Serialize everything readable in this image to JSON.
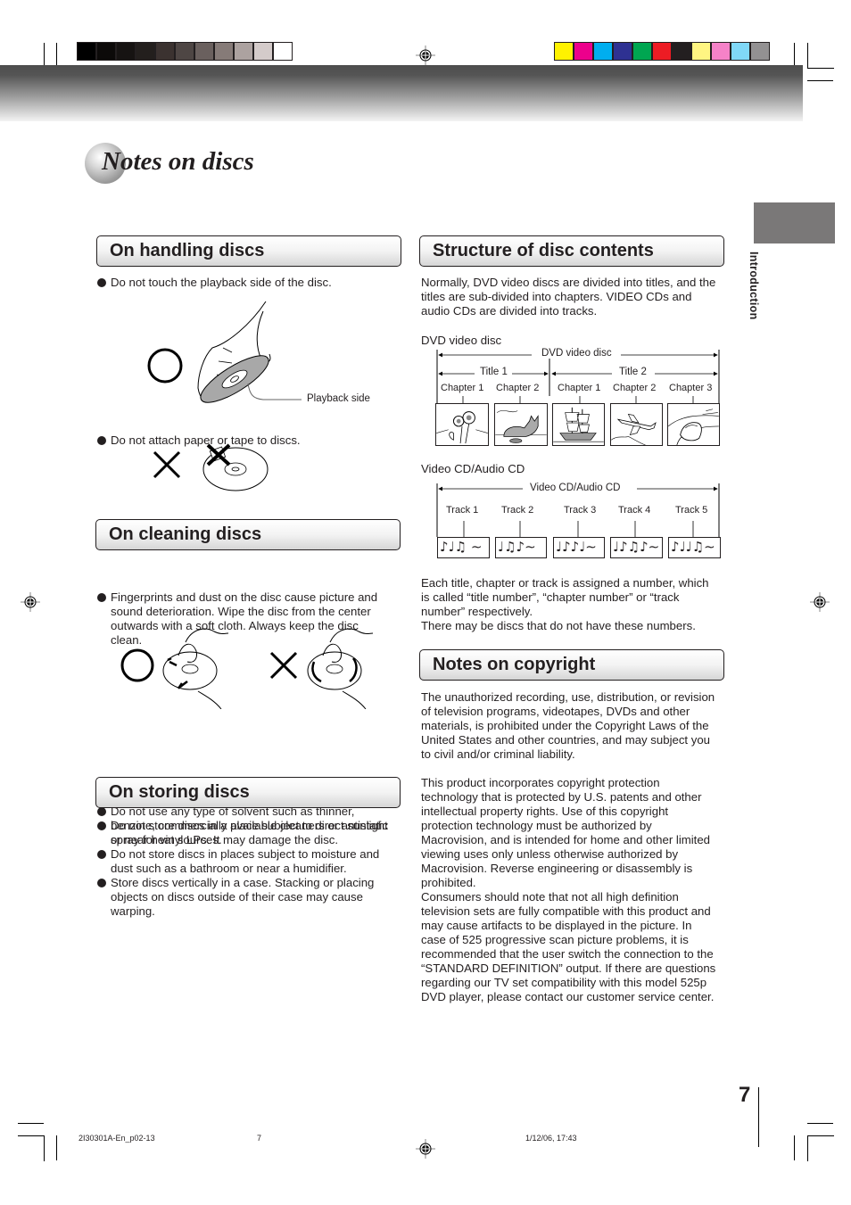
{
  "print_marks": {
    "gray_swatches": [
      "#000000",
      "#0c0a09",
      "#161312",
      "#231f1d",
      "#3b3230",
      "#4e4644",
      "#6a605e",
      "#867b78",
      "#aca2a0",
      "#d4cbca",
      "#ffffff"
    ],
    "color_swatches": [
      "#fff200",
      "#ec008c",
      "#00aeef",
      "#2e3192",
      "#00a651",
      "#ed1c24",
      "#231f20",
      "#fff582",
      "#f582c8",
      "#80d8f7",
      "#939192"
    ]
  },
  "header": {
    "page_title": "Notes on discs"
  },
  "side_tab": {
    "label": "Introduction"
  },
  "sections": {
    "handling": {
      "title": "On handling discs",
      "bullet_1": "Do not touch the playback side of the disc.",
      "playback_side_label": "Playback side",
      "bullet_2": "Do not attach paper or tape to discs."
    },
    "cleaning": {
      "title": "On cleaning discs",
      "bullet_1_lines": [
        "Fingerprints and dust on the disc cause picture and",
        "sound deterioration. Wipe the disc from the center",
        "outwards with a soft cloth. Always keep the disc",
        "clean."
      ],
      "bullet_2_lines": [
        "Do not use any type of solvent such as thinner,",
        "benzine, commercially available cleaners or antistatic",
        "spray for vinyl LPs. It may damage the disc."
      ]
    },
    "storing": {
      "title": "On storing discs",
      "bullets": [
        [
          "Do not store discs in a place subject to direct sunlight",
          "or near heat sources."
        ],
        [
          "Do not store discs in places subject to moisture and",
          "dust such as a bathroom or near a humidifier."
        ],
        [
          "Store discs vertically in a case. Stacking or placing",
          "objects on discs outside of their case may cause",
          "warping."
        ]
      ]
    },
    "structure": {
      "title": "Structure of disc contents",
      "intro_lines": [
        "Normally, DVD video discs are divided into titles, and the",
        "titles are sub-divided into chapters. VIDEO CDs and",
        "audio CDs are divided into tracks."
      ],
      "dvd_caption": "DVD video disc",
      "dvd_diagram": {
        "span_label": "DVD video disc",
        "titles": [
          {
            "label": "Title 1",
            "chapters": [
              {
                "label": "Chapter 1",
                "picture": "sunflowers"
              },
              {
                "label": "Chapter 2",
                "picture": "cat"
              }
            ]
          },
          {
            "label": "Title 2",
            "chapters": [
              {
                "label": "Chapter 1",
                "picture": "sailing-ship"
              },
              {
                "label": "Chapter 2",
                "picture": "airplane"
              },
              {
                "label": "Chapter 3",
                "picture": "car"
              }
            ]
          }
        ]
      },
      "cd_caption": "Video CD/Audio CD",
      "cd_diagram": {
        "span_label": "Video CD/Audio CD",
        "tracks": [
          {
            "label": "Track 1",
            "notes": "♪♩♫ ∼"
          },
          {
            "label": "Track 2",
            "notes": "♩♫♪∼"
          },
          {
            "label": "Track 3",
            "notes": "♩♪♪♩∼"
          },
          {
            "label": "Track 4",
            "notes": "♩♪♫♪∼"
          },
          {
            "label": "Track 5",
            "notes": "♪♩♩♫∼"
          }
        ]
      },
      "numbers_lines": [
        "Each title, chapter or track is assigned a number, which",
        "is called “title number”, “chapter number” or “track",
        "number” respectively.",
        "There may be discs that do not have these numbers."
      ]
    },
    "copyright": {
      "title": "Notes on copyright",
      "para_1_lines": [
        "The unauthorized recording, use, distribution, or revision",
        "of television programs, videotapes, DVDs and other",
        "materials, is prohibited under the Copyright Laws of the",
        "United States and other countries, and may subject you",
        "to civil and/or criminal liability."
      ],
      "para_2_lines": [
        "This product incorporates copyright protection",
        "technology that is protected by U.S. patents and other",
        "intellectual property rights. Use of this copyright",
        "protection technology must be authorized by",
        "Macrovision, and is intended for home and other limited",
        "viewing uses only unless otherwise authorized by",
        "Macrovision. Reverse engineering or disassembly is",
        "prohibited.",
        "Consumers should note that not all high definition",
        "television sets are fully compatible with this product and",
        "may cause artifacts to be displayed in the picture. In",
        "case of 525 progressive scan picture problems, it is",
        "recommended that the user switch the connection to the",
        "“STANDARD DEFINITION” output. If there are questions",
        "regarding our TV set compatibility with this model 525p",
        "DVD player, please contact our customer service center."
      ]
    }
  },
  "footer": {
    "page_number": "7",
    "file_name": "2I30301A-En_p02-13",
    "file_page": "7",
    "timestamp": "1/12/06, 17:43"
  }
}
